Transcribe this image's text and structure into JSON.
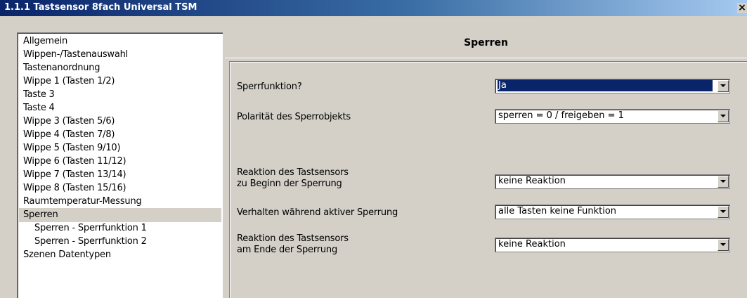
{
  "window": {
    "title": "1.1.1 Tastsensor 8fach Universal TSM",
    "close_glyph": "×"
  },
  "sidebar": {
    "items": [
      {
        "label": "Allgemein",
        "selected": false,
        "sub": false
      },
      {
        "label": "Wippen-/Tastenauswahl",
        "selected": false,
        "sub": false
      },
      {
        "label": "Tastenanordnung",
        "selected": false,
        "sub": false
      },
      {
        "label": "Wippe 1 (Tasten 1/2)",
        "selected": false,
        "sub": false
      },
      {
        "label": "Taste 3",
        "selected": false,
        "sub": false
      },
      {
        "label": "Taste 4",
        "selected": false,
        "sub": false
      },
      {
        "label": "Wippe 3 (Tasten 5/6)",
        "selected": false,
        "sub": false
      },
      {
        "label": "Wippe 4 (Tasten 7/8)",
        "selected": false,
        "sub": false
      },
      {
        "label": "Wippe 5 (Tasten 9/10)",
        "selected": false,
        "sub": false
      },
      {
        "label": "Wippe 6 (Tasten 11/12)",
        "selected": false,
        "sub": false
      },
      {
        "label": "Wippe 7 (Tasten 13/14)",
        "selected": false,
        "sub": false
      },
      {
        "label": "Wippe 8 (Tasten 15/16)",
        "selected": false,
        "sub": false
      },
      {
        "label": "Raumtemperatur-Messung",
        "selected": false,
        "sub": false
      },
      {
        "label": "Sperren",
        "selected": true,
        "sub": false
      },
      {
        "label": "Sperren - Sperrfunktion 1",
        "selected": false,
        "sub": true
      },
      {
        "label": "Sperren - Sperrfunktion 2",
        "selected": false,
        "sub": true
      },
      {
        "label": "Szenen Datentypen",
        "selected": false,
        "sub": false
      }
    ]
  },
  "main": {
    "section_title": "Sperren",
    "params": [
      {
        "label_lines": [
          "Sperrfunktion?"
        ],
        "value": "Ja",
        "active": true
      },
      {
        "label_lines": [
          "Polarität des Sperrobjekts"
        ],
        "value": "sperren = 0 / freigeben = 1",
        "active": false
      },
      {
        "label_lines": [
          "Reaktion des Tastsensors",
          "zu Beginn der Sperrung"
        ],
        "value": "keine Reaktion",
        "active": false
      },
      {
        "label_lines": [
          "Verhalten während aktiver Sperrung"
        ],
        "value": "alle Tasten keine Funktion",
        "active": false
      },
      {
        "label_lines": [
          "Reaktion des Tastsensors",
          "am Ende der Sperrung"
        ],
        "value": "keine Reaktion",
        "active": false
      }
    ]
  },
  "colors": {
    "face": "#d4d0c8",
    "selection": "#0a246a",
    "title_gradient_start": "#0a246a",
    "title_gradient_end": "#a6caf0"
  },
  "icons": {
    "dropdown": "triangle-down-icon",
    "close": "close-icon"
  }
}
